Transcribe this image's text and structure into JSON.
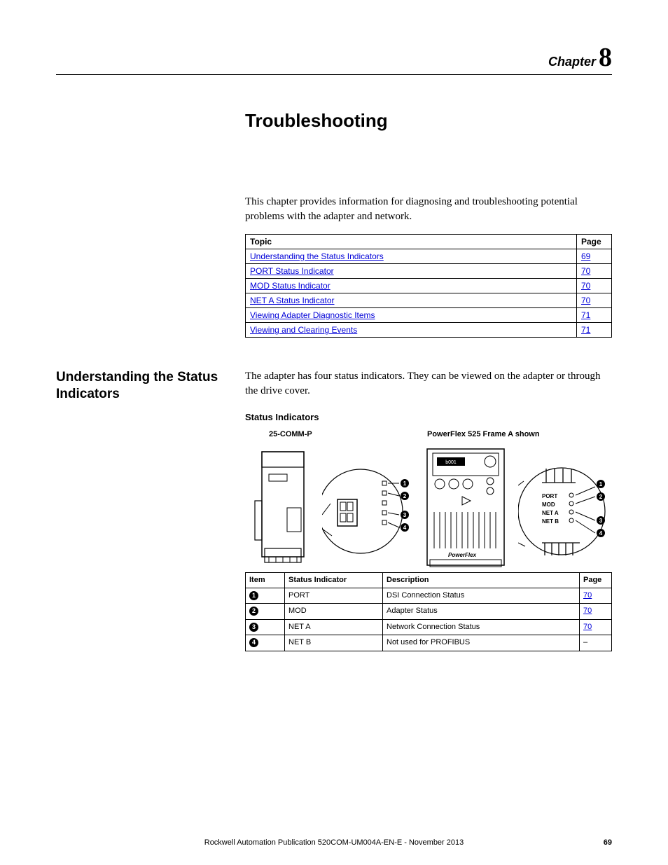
{
  "chapter": {
    "label": "Chapter",
    "number": "8"
  },
  "title": "Troubleshooting",
  "intro": "This chapter provides information for diagnosing and troubleshooting potential problems with the adapter and network.",
  "toc": {
    "headers": {
      "topic": "Topic",
      "page": "Page"
    },
    "rows": [
      {
        "topic": "Understanding the Status Indicators",
        "page": "69"
      },
      {
        "topic": "PORT Status Indicator",
        "page": "70"
      },
      {
        "topic": "MOD Status Indicator",
        "page": "70"
      },
      {
        "topic": "NET A Status Indicator",
        "page": "70"
      },
      {
        "topic": "Viewing Adapter Diagnostic Items",
        "page": "71"
      },
      {
        "topic": "Viewing and Clearing Events",
        "page": "71"
      }
    ]
  },
  "section": {
    "heading": "Understanding the Status Indicators",
    "body": "The adapter has four status indicators. They can be viewed on the adapter or through the drive cover.",
    "figure_title": "Status Indicators",
    "caption_left": "25-COMM-P",
    "caption_right": "PowerFlex 525 Frame A shown",
    "led_labels": {
      "l1": "PORT",
      "l2": "MOD",
      "l3": "NET A",
      "l4": "NET B"
    }
  },
  "indicators": {
    "headers": {
      "item": "Item",
      "si": "Status Indicator",
      "desc": "Description",
      "page": "Page"
    },
    "rows": [
      {
        "n": "1",
        "si": "PORT",
        "desc": "DSI Connection Status",
        "page": "70"
      },
      {
        "n": "2",
        "si": "MOD",
        "desc": "Adapter Status",
        "page": "70"
      },
      {
        "n": "3",
        "si": "NET A",
        "desc": "Network Connection Status",
        "page": "70"
      },
      {
        "n": "4",
        "si": "NET B",
        "desc": "Not used for PROFIBUS",
        "page": "–"
      }
    ]
  },
  "footer": {
    "text": "Rockwell Automation Publication 520COM-UM004A-EN-E - November 2013",
    "page": "69"
  }
}
